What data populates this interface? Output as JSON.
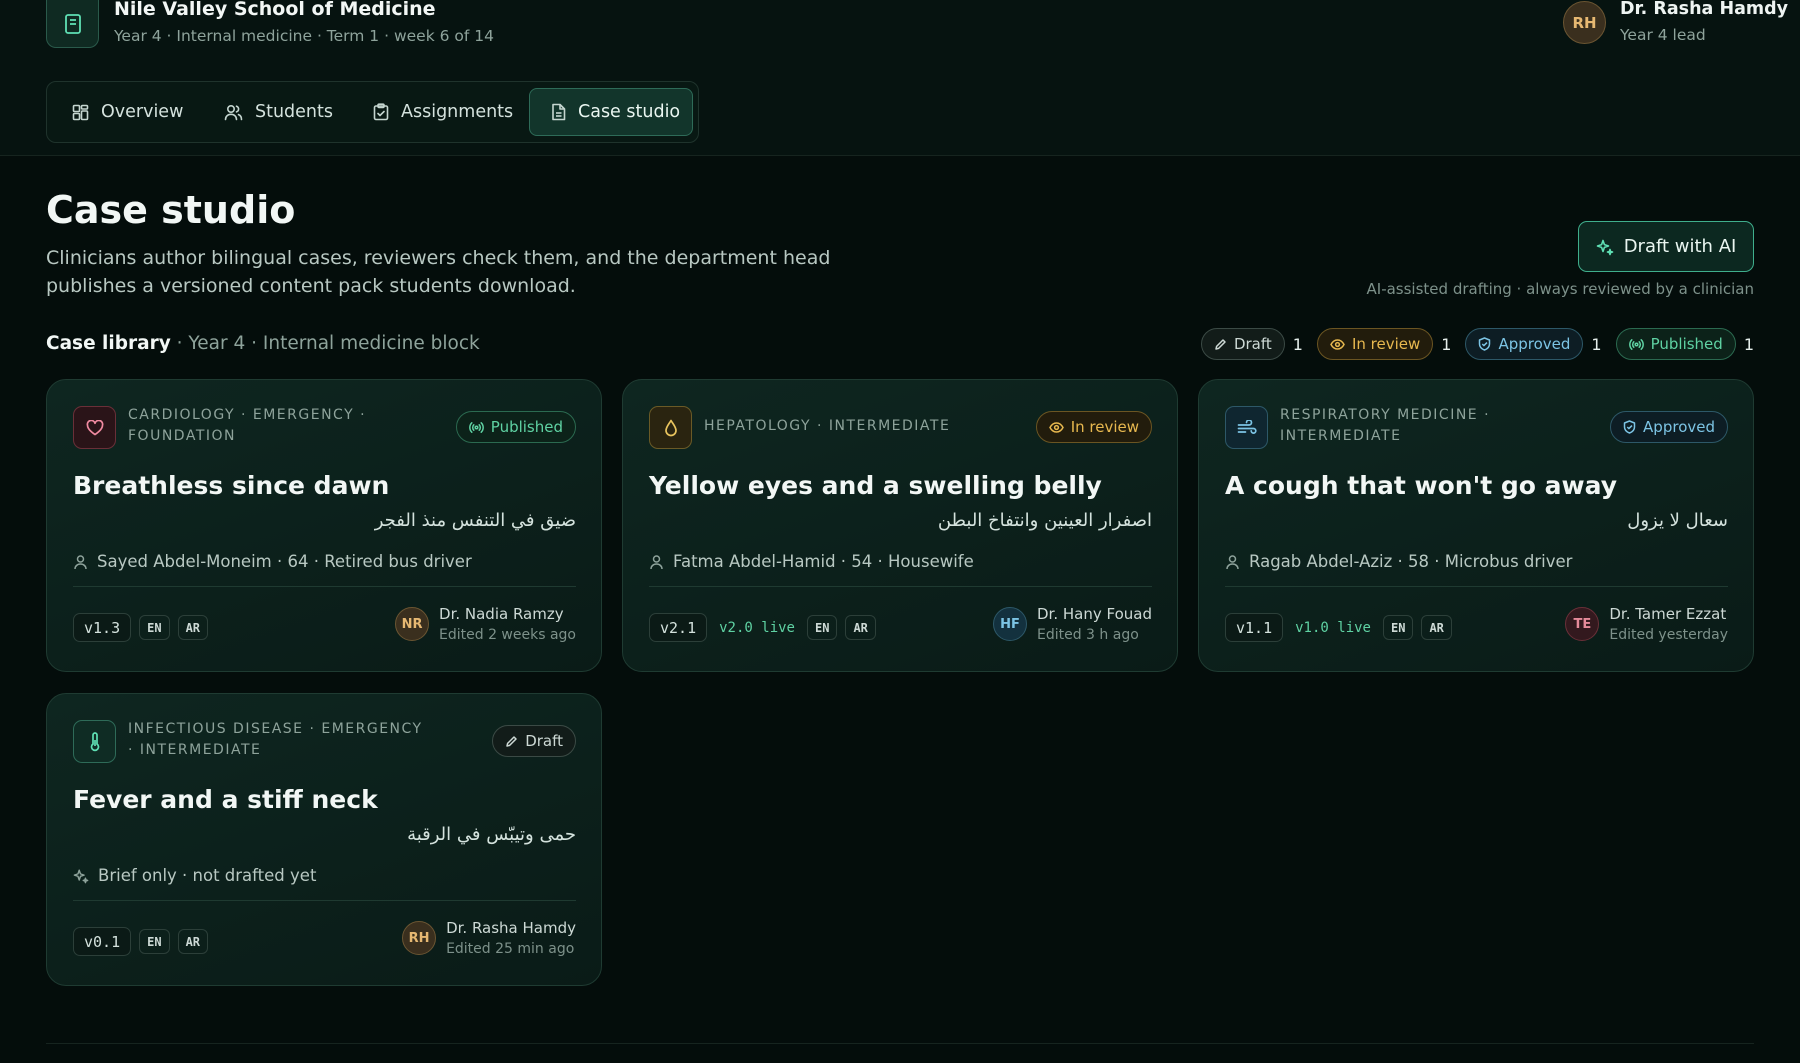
{
  "school": {
    "name": "Nile Valley School of Medicine",
    "subtitle": "Year 4 · Internal medicine · Term 1 · week 6 of 14"
  },
  "user": {
    "initials": "RH",
    "name": "Dr. Rasha Hamdy",
    "role": "Year 4 lead"
  },
  "tabs": [
    {
      "label": "Overview",
      "icon": "grid-icon"
    },
    {
      "label": "Students",
      "icon": "users-icon"
    },
    {
      "label": "Assignments",
      "icon": "clipboard-icon"
    },
    {
      "label": "Case studio",
      "icon": "document-icon",
      "active": true
    }
  ],
  "page": {
    "title": "Case studio",
    "description": "Clinicians author bilingual cases, reviewers check them, and the department head publishes a versioned content pack students download.",
    "ai_button": "Draft with AI",
    "ai_note": "AI-assisted drafting · always reviewed by a clinician"
  },
  "library": {
    "label": "Case library",
    "context": " · Year 4 · Internal medicine block",
    "filters": [
      {
        "label": "Draft",
        "count": "1",
        "icon": "pencil-icon"
      },
      {
        "label": "In review",
        "count": "1",
        "icon": "eye-icon"
      },
      {
        "label": "Approved",
        "count": "1",
        "icon": "shield-check-icon"
      },
      {
        "label": "Published",
        "count": "1",
        "icon": "broadcast-icon"
      }
    ]
  },
  "cases": [
    {
      "tags": "CARDIOLOGY · EMERGENCY · FOUNDATION",
      "icon": "heart-icon",
      "status": "Published",
      "title": "Breathless since dawn",
      "title_ar": "ضيق في التنفس منذ الفجر",
      "patient": "Sayed Abdel-Moneim ·  64  · Retired bus driver",
      "version": "v1.3",
      "live": "",
      "langs": [
        "EN",
        "AR"
      ],
      "author_initials": "NR",
      "author": "Dr. Nadia Ramzy",
      "edited": "Edited 2 weeks ago"
    },
    {
      "tags": "HEPATOLOGY · INTERMEDIATE",
      "icon": "drop-icon",
      "status": "In review",
      "title": "Yellow eyes and a swelling belly",
      "title_ar": "اصفرار العينين وانتفاخ البطن",
      "patient": "Fatma Abdel-Hamid ·  54  · Housewife",
      "version": "v2.1",
      "live": "v2.0 live",
      "langs": [
        "EN",
        "AR"
      ],
      "author_initials": "HF",
      "author": "Dr. Hany Fouad",
      "edited": "Edited 3 h ago"
    },
    {
      "tags": "RESPIRATORY MEDICINE · INTERMEDIATE",
      "icon": "wind-icon",
      "status": "Approved",
      "title": "A cough that won't go away",
      "title_ar": "سعال لا يزول",
      "patient": "Ragab Abdel-Aziz ·  58  · Microbus driver",
      "version": "v1.1",
      "live": "v1.0 live",
      "langs": [
        "EN",
        "AR"
      ],
      "author_initials": "TE",
      "author": "Dr. Tamer Ezzat",
      "edited": "Edited yesterday"
    },
    {
      "tags": "INFECTIOUS DISEASE · EMERGENCY · INTERMEDIATE",
      "icon": "thermometer-icon",
      "status": "Draft",
      "title": "Fever and a stiff neck",
      "title_ar": "حمى وتيبّس في الرقبة",
      "patient": "Brief only · not drafted yet",
      "version": "v0.1",
      "live": "",
      "langs": [
        "EN",
        "AR"
      ],
      "author_initials": "RH",
      "author": "Dr. Rasha Hamdy",
      "edited": "Edited 25 min ago"
    }
  ],
  "colors": {
    "background": "#040d0b",
    "accent": "#5fe0b4",
    "published": "#5fd2a3",
    "in_review": "#e7b84f",
    "approved": "#7cc4e4",
    "draft": "#cdd9d5"
  }
}
